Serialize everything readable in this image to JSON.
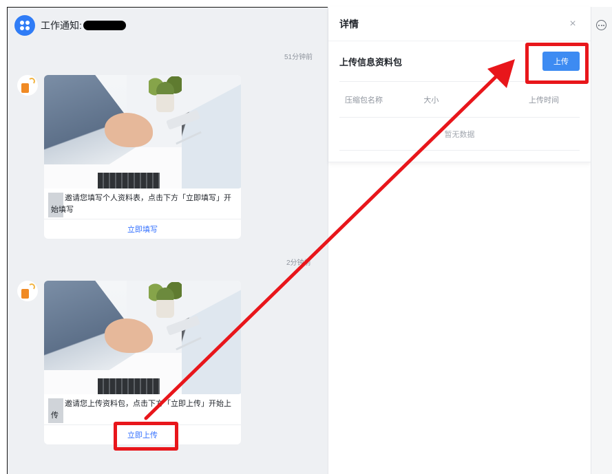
{
  "header": {
    "app_title": "工作通知:"
  },
  "messages": [
    {
      "time": "51分钟前",
      "text": "邀请您填写个人资料表，点击下方「立即填写」开始填写",
      "action_label": "立即填写"
    },
    {
      "time": "2分钟前",
      "text": "邀请您上传资料包，点击下方「立即上传」开始上传",
      "action_label": "立即上传"
    }
  ],
  "detail": {
    "title": "详情",
    "close_icon": "×",
    "package_title": "上传信息资料包",
    "upload_label": "上传",
    "columns": [
      "压缩包名称",
      "大小",
      "上传时间"
    ],
    "empty_text": "暂无数据"
  },
  "colors": {
    "accent": "#3370ff",
    "upload_button": "#3d8bf2",
    "annotation_red": "#e8161b",
    "chat_background": "#eef0f3"
  },
  "icons": {
    "app_logo": "flower-logo-icon",
    "close": "close-icon",
    "more": "more-icon",
    "avatar": "document-avatar-icon"
  }
}
